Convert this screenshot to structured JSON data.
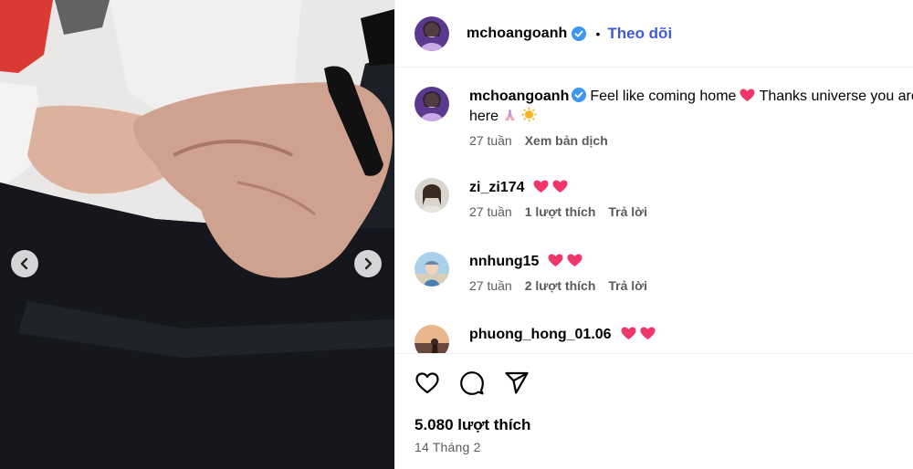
{
  "post": {
    "author": "mchoangoanh",
    "follow_label": "Theo dõi",
    "separator": "•",
    "caption": {
      "username": "mchoangoanh",
      "text": "Feel like coming home",
      "text2": " Thanks universe you are here",
      "time": "27 tuần",
      "translate": "Xem bản dịch"
    },
    "comments": [
      {
        "username": "zi_zi174",
        "time": "27 tuần",
        "likes": "1 lượt thích",
        "reply": "Trả lời"
      },
      {
        "username": "nnhung15",
        "time": "27 tuần",
        "likes": "2 lượt thích",
        "reply": "Trả lời"
      },
      {
        "username": "phuong_hong_01.06"
      }
    ],
    "likes_count": "5.080 lượt thích",
    "date": "14 Tháng 2"
  },
  "icons": {
    "verified": "verified-badge-icon",
    "like": "heart-outline-icon",
    "comment": "comment-bubble-icon",
    "share": "paper-plane-icon",
    "prev": "chevron-left-icon",
    "next": "chevron-right-icon",
    "emoji_heart": "pink-heart-emoji",
    "emoji_pray": "praying-hands-emoji",
    "emoji_sun": "sun-emoji"
  },
  "colors": {
    "follow": "#3f5bd7",
    "verified": "#3d96f0",
    "heart": "#f0366b"
  }
}
